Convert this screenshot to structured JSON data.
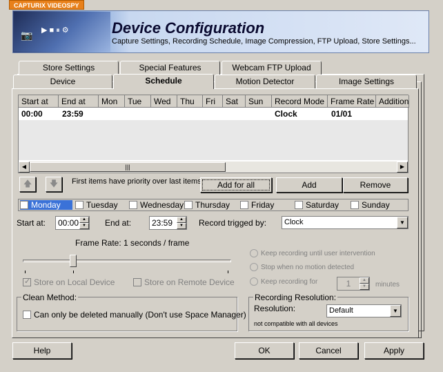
{
  "app": {
    "name": "CAPTURIX VIDEOSPY"
  },
  "header": {
    "title": "Device Configuration",
    "subtitle": "Capture Settings, Recording Schedule,  Image Compression, FTP Upload, Store Settings..."
  },
  "tabs_back": [
    "Store Settings",
    "Special Features",
    "Webcam FTP Upload"
  ],
  "tabs_front": [
    "Device",
    "Schedule",
    "Motion Detector",
    "Image Settings"
  ],
  "active_tab": "Schedule",
  "schedule_table": {
    "columns": [
      "Start at",
      "End at",
      "Mon",
      "Tue",
      "Wed",
      "Thu",
      "Fri",
      "Sat",
      "Sun",
      "Record Mode",
      "Frame Rate",
      "Addition"
    ],
    "rows": [
      {
        "start": "00:00",
        "end": "23:59",
        "mode": "Clock",
        "rate": "01/01"
      }
    ]
  },
  "priority_note": "First items have priority over last items.",
  "buttons": {
    "add_for_all": "Add for all",
    "add": "Add",
    "remove": "Remove"
  },
  "days": [
    {
      "label": "Monday",
      "checked": false,
      "selected": true
    },
    {
      "label": "Tuesday",
      "checked": false
    },
    {
      "label": "Wednesday",
      "checked": false
    },
    {
      "label": "Thursday",
      "checked": false
    },
    {
      "label": "Friday",
      "checked": false
    },
    {
      "label": "Saturday",
      "checked": false
    },
    {
      "label": "Sunday",
      "checked": false
    }
  ],
  "start_at": {
    "label": "Start at:",
    "value": "00:00"
  },
  "end_at": {
    "label": "End at:",
    "value": "23:59"
  },
  "record_trigger": {
    "label": "Record trigged by:",
    "value": "Clock"
  },
  "frame_rate": {
    "label": "Frame Rate: 1 seconds / frame"
  },
  "recording_options": {
    "until_user": "Keep recording until user intervention",
    "stop_no_motion": "Stop when no motion detected",
    "keep_for": "Keep recording for",
    "minutes_value": "1",
    "minutes_unit": "minutes"
  },
  "store": {
    "local": "Store on Local Device",
    "local_checked": true,
    "remote": "Store on Remote Device",
    "remote_checked": false
  },
  "clean_method": {
    "title": "Clean Method:",
    "option": "Can only be deleted manually (Don't use Space Manager)"
  },
  "recording_resolution": {
    "title": "Recording Resolution:",
    "label": "Resolution:",
    "value": "Default",
    "note": "not compatible with all devices"
  },
  "footer": {
    "help": "Help",
    "ok": "OK",
    "cancel": "Cancel",
    "apply": "Apply"
  },
  "colors": {
    "header_dark": "#2a3a6e",
    "header_light": "#dfe8f7",
    "day_selected": "#3a72d8",
    "appname_bg": "#e8801a"
  }
}
